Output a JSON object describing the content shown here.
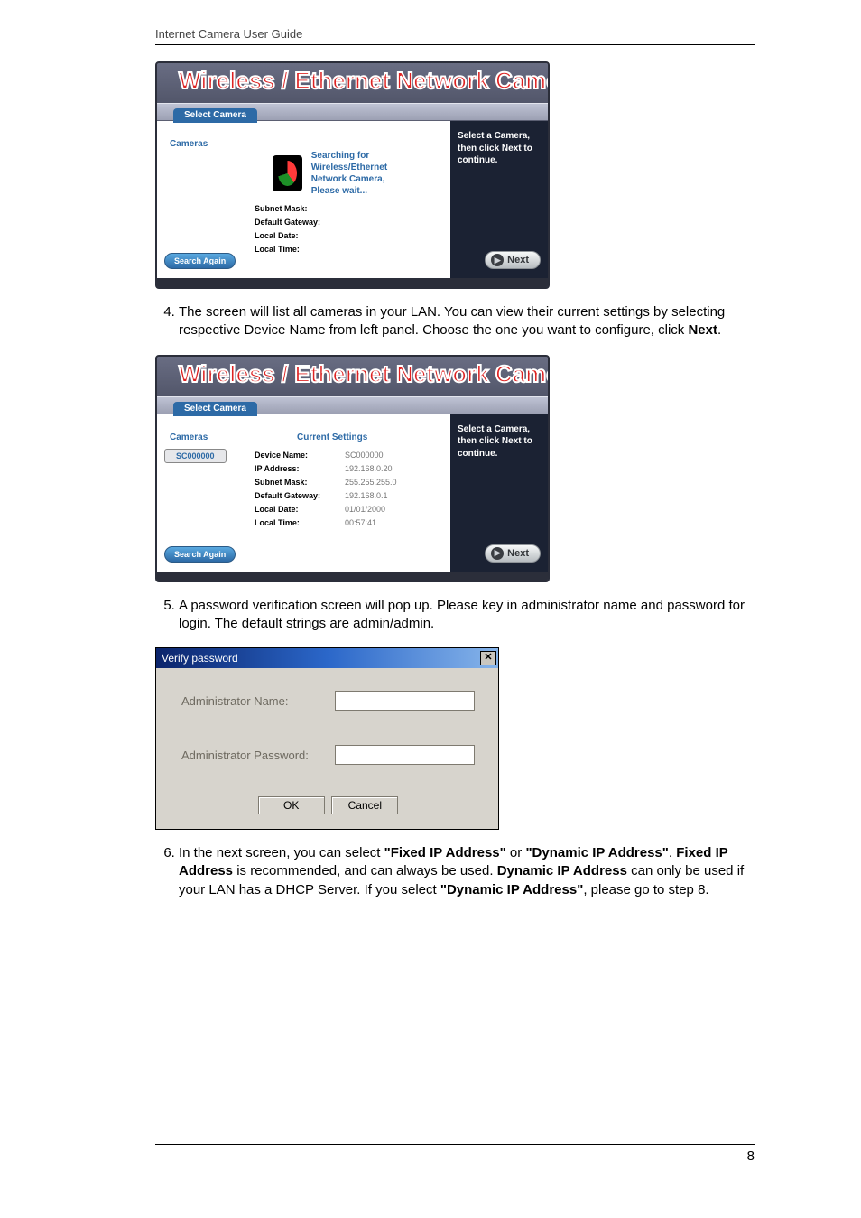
{
  "header": "Internet Camera User Guide",
  "page_number": "8",
  "wizard_title": "Wireless / Ethernet  Network  Camera",
  "select_camera_tab": "Select Camera",
  "cameras_label": "Cameras",
  "current_settings_label": "Current Settings",
  "search_again": "Search Again",
  "side_hint": "Select a Camera, then click Next to continue.",
  "next_label": "Next",
  "searching": {
    "line1": "Searching for Wireless/Ethernet",
    "line2": "Network Camera,",
    "line3": "Please wait..."
  },
  "fields1": {
    "subnet_mask": "Subnet Mask:",
    "default_gateway": "Default Gateway:",
    "local_date": "Local Date:",
    "local_time": "Local Time:"
  },
  "camera_entry": "SC000000",
  "fields2": {
    "device_name_k": "Device Name:",
    "device_name_v": "SC000000",
    "ip_address_k": "IP Address:",
    "ip_address_v": "192.168.0.20",
    "subnet_mask_k": "Subnet Mask:",
    "subnet_mask_v": "255.255.255.0",
    "default_gateway_k": "Default Gateway:",
    "default_gateway_v": "192.168.0.1",
    "local_date_k": "Local Date:",
    "local_date_v": "01/01/2000",
    "local_time_k": "Local Time:",
    "local_time_v": "00:57:41"
  },
  "steps": {
    "4a": "The screen will list all cameras in your LAN. You can view their current settings by selecting respective Device Name from left panel. Choose the one you want to configure, click ",
    "4b": "Next",
    "4c": ".",
    "5": "A password verification screen will pop up. Please key in administrator name and password for login. The default strings are admin/admin.",
    "6a": "In the next screen, you can select ",
    "6b": "\"Fixed IP Address\"",
    "6c": " or ",
    "6d": "\"Dynamic IP Address\"",
    "6e": ". ",
    "6f": "Fixed IP Address",
    "6g": " is recommended, and can always be used.  ",
    "6h": "Dynamic IP Address",
    "6i": " can only be used if your LAN has a DHCP Server. If you select ",
    "6j": "\"Dynamic IP Address\"",
    "6k": ", please go to step 8."
  },
  "dialog": {
    "title": "Verify password",
    "admin_name": "Administrator Name:",
    "admin_password": "Administrator Password:",
    "ok": "OK",
    "cancel": "Cancel"
  }
}
